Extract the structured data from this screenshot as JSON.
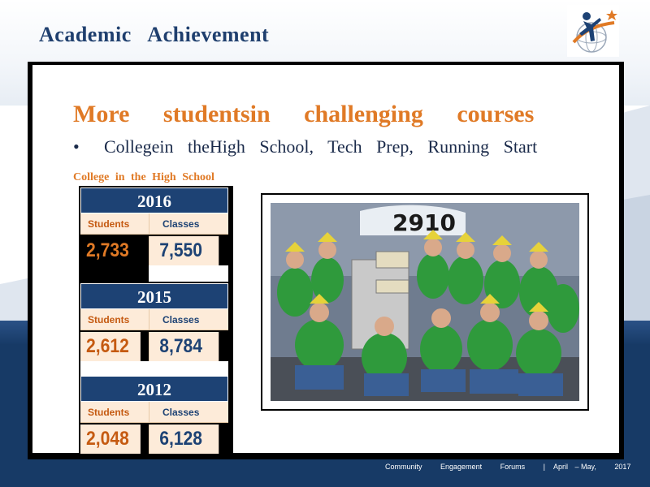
{
  "slide": {
    "title": "Academic Achievement",
    "heading": "More studentsin challenging courses",
    "bullet": "•",
    "bullet_text": "Collegein theHigh School, Tech Prep, Running Start",
    "subheading": "College in the High School"
  },
  "stats": {
    "student_label": "Students",
    "class_label": "Classes",
    "years": [
      {
        "year": "2016",
        "students": "2,733",
        "classes": "7,550"
      },
      {
        "year": "2015",
        "students": "2,612",
        "classes": "8,784"
      },
      {
        "year": "2012",
        "students": "2,048",
        "classes": "6,128"
      }
    ]
  },
  "photo": {
    "banner_text": "2910"
  },
  "footer": {
    "items": [
      "Community",
      "Engagement",
      "Forums",
      "|",
      "April",
      "– May,",
      "2017"
    ]
  },
  "colors": {
    "title_navy": "#1f3f6e",
    "accent_orange": "#e07a26",
    "table_header_navy": "#1d4274",
    "table_cell_peach": "#fdebd9",
    "footer_band": "#173a66"
  },
  "icons": {
    "logo": "person-globe-star-logo"
  }
}
